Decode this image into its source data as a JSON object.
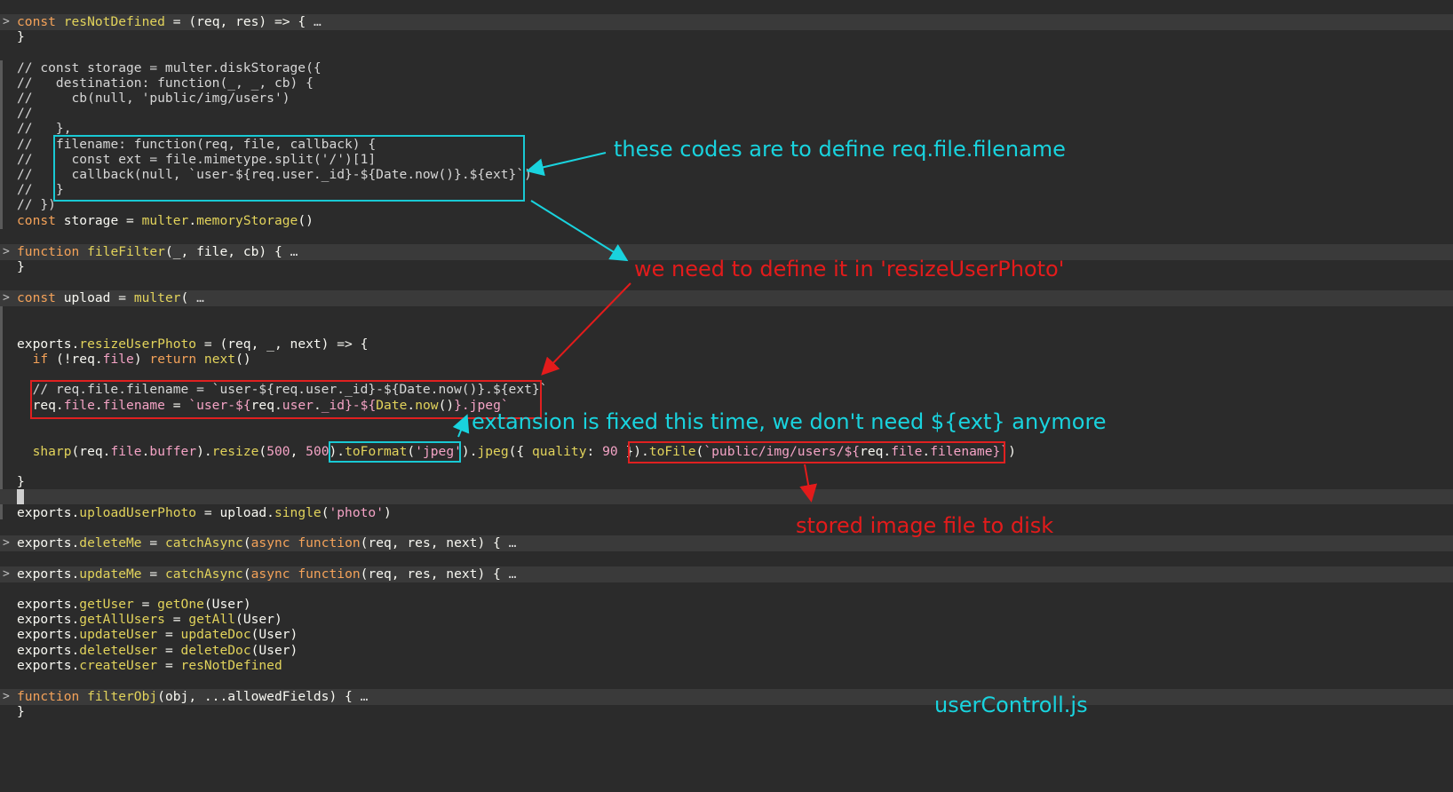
{
  "file_label": "userControll.js",
  "annotations": {
    "define_filename": "these codes are to define req.file.filename",
    "need_define": "we need to define it in 'resizeUserPhoto'",
    "extension_fixed": "extansion is fixed this time, we don't need ${ext} anymore",
    "stored_to_disk": "stored image file to disk"
  },
  "colors": {
    "background": "#2b2b2b",
    "folded_line": "#3a3a3a",
    "annotation_cyan": "#19d3de",
    "annotation_red": "#e31b1b"
  },
  "code": {
    "l1": "const resNotDefined = (req, res) => { …",
    "l2": "}",
    "l3": "// const storage = multer.diskStorage({",
    "l4": "//   destination: function(_, _, cb) {",
    "l5": "//     cb(null, 'public/img/users')",
    "l6": "//",
    "l7": "//   },",
    "l8a": "//   ",
    "l8b": "filename: function(req, file, callback) {",
    "l9a": "//   ",
    "l9b": "  const ext = file.mimetype.split('/')[1]",
    "l10a": "//   ",
    "l10b": "  callback(null, `user-${req.user._id}-${Date.now()}.${ext}`)",
    "l11a": "//   ",
    "l11b": "}",
    "l12": "// })",
    "l13": "const storage = multer.memoryStorage()",
    "l14": "function fileFilter(_, file, cb) { …",
    "l15": "}",
    "l16": "const upload = multer( …",
    "l17": "exports.resizeUserPhoto = (req, _, next) => {",
    "l18": "  if (!req.file) return next()",
    "l19": "  // req.file.filename = `user-${req.user._id}-${Date.now()}.${ext}`",
    "l20": "  req.file.filename = `user-${req.user._id}-${Date.now()}.jpeg`",
    "l21a": "  sharp(req.file.buffer).resize(500, 500)",
    "l21b": ".toFormat('jpeg')",
    "l21c": ".jpeg({ quality: 90 })",
    "l21d": ".toFile(`public/img/users/${req.file.filename}`)",
    "l22": "}",
    "l23": "exports.uploadUserPhoto = upload.single('photo')",
    "l24": "exports.deleteMe = catchAsync(async function(req, res, next) { …",
    "l25": "exports.updateMe = catchAsync(async function(req, res, next) { …",
    "l26": "exports.getUser = getOne(User)",
    "l27": "exports.getAllUsers = getAll(User)",
    "l28": "exports.updateUser = updateDoc(User)",
    "l29": "exports.deleteUser = deleteDoc(User)",
    "l30": "exports.createUser = resNotDefined",
    "l31": "function filterObj(obj, ...allowedFields) { …",
    "l32": "}"
  }
}
